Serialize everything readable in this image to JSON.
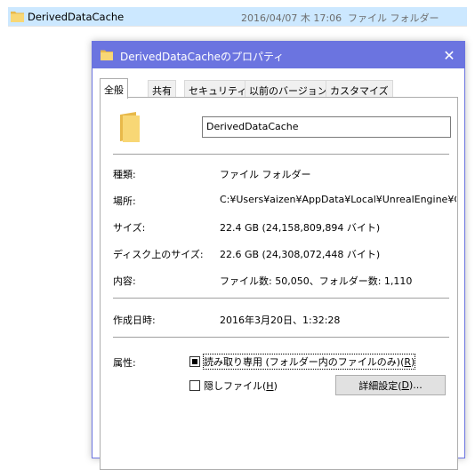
{
  "explorer": {
    "name": "DerivedDataCache",
    "date": "2016/04/07 木 17:06",
    "type": "ファイル フォルダー"
  },
  "dialog": {
    "title": "DerivedDataCacheのプロパティ",
    "close_icon": "close-icon",
    "tabs": [
      "全般",
      "共有",
      "セキュリティ",
      "以前のバージョン",
      "カスタマイズ"
    ],
    "active_tab": 0,
    "folder_name": "DerivedDataCache",
    "fields": [
      {
        "label": "種類:",
        "value": "ファイル フォルダー"
      },
      {
        "label": "場所:",
        "value": "C:¥Users¥aizen¥AppData¥Local¥UnrealEngine¥Co"
      },
      {
        "label": "サイズ:",
        "value": "22.4 GB (24,158,809,894 バイト)"
      },
      {
        "label": "ディスク上のサイズ:",
        "value": "22.6 GB (24,308,072,448 バイト)"
      },
      {
        "label": "内容:",
        "value": "ファイル数: 50,050、フォルダー数: 1,110"
      }
    ],
    "created_label": "作成日時:",
    "created_value": "2016年3月20日、1:32:28",
    "attributes_label": "属性:",
    "readonly": {
      "text": "読み取り専用 (フォルダー内のファイルのみ)(",
      "key": "R",
      "tail": ")",
      "state": "indeterminate"
    },
    "hidden": {
      "text": "隠しファイル(",
      "key": "H",
      "tail": ")",
      "state": "unchecked"
    },
    "advanced_button": {
      "text": "詳細設定(",
      "key": "D",
      "tail": ")..."
    }
  },
  "colors": {
    "titlebar": "#6b74e0",
    "selection": "#cce8ff",
    "folder": "#f8d775"
  }
}
